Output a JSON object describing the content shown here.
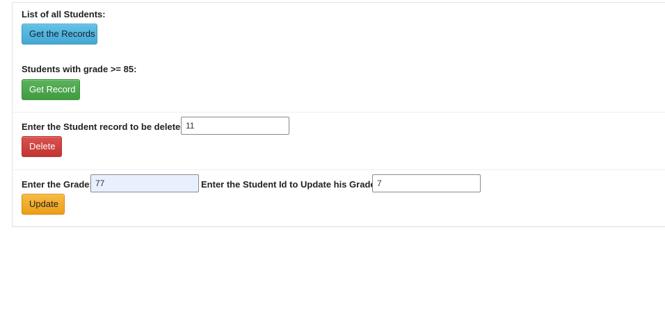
{
  "list_section": {
    "heading": "List of all Students:",
    "button_label": "Get the Records"
  },
  "grade_section": {
    "heading": "Students with grade >= 85:",
    "button_label": "Get Record"
  },
  "delete_section": {
    "label": "Enter the Student record to be deleted",
    "input_value": "11",
    "button_label": "Delete"
  },
  "update_section": {
    "grade_label": "Enter the Grade:",
    "grade_value": "77",
    "id_label": "Enter the Student Id to Update his Grade:",
    "id_value": "7",
    "button_label": "Update"
  }
}
